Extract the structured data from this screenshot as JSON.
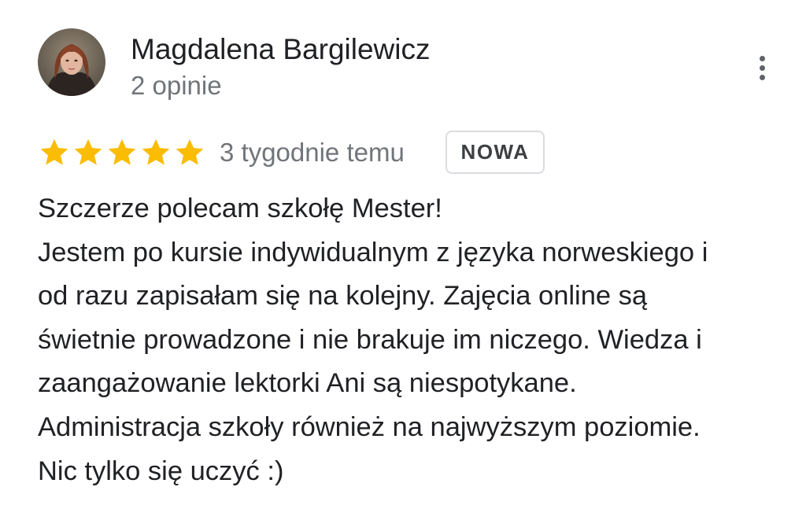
{
  "review": {
    "author": {
      "name": "Magdalena Bargilewicz",
      "reviews_count": "2 opinie",
      "avatar_icon": "profile-photo"
    },
    "rating": 5,
    "rating_max": 5,
    "time_ago": "3 tygodnie temu",
    "badge": "NOWA",
    "more_icon": "more-vert-icon",
    "text_lines": [
      "Szczerze polecam szkołę Mester!",
      "Jestem po kursie indywidualnym z języka norweskiego i",
      "od razu zapisałam się na kolejny. Zajęcia online są",
      "świetnie prowadzone i nie brakuje im niczego. Wiedza i",
      "zaangażowanie lektorki Ani są niespotykane.",
      "Administracja szkoły również na najwyższym poziomie.",
      "Nic tylko się uczyć :)"
    ]
  },
  "colors": {
    "star": "#FBBC04",
    "secondary_text": "#70757a",
    "primary_text": "#202124",
    "badge_border": "#dadce0"
  }
}
